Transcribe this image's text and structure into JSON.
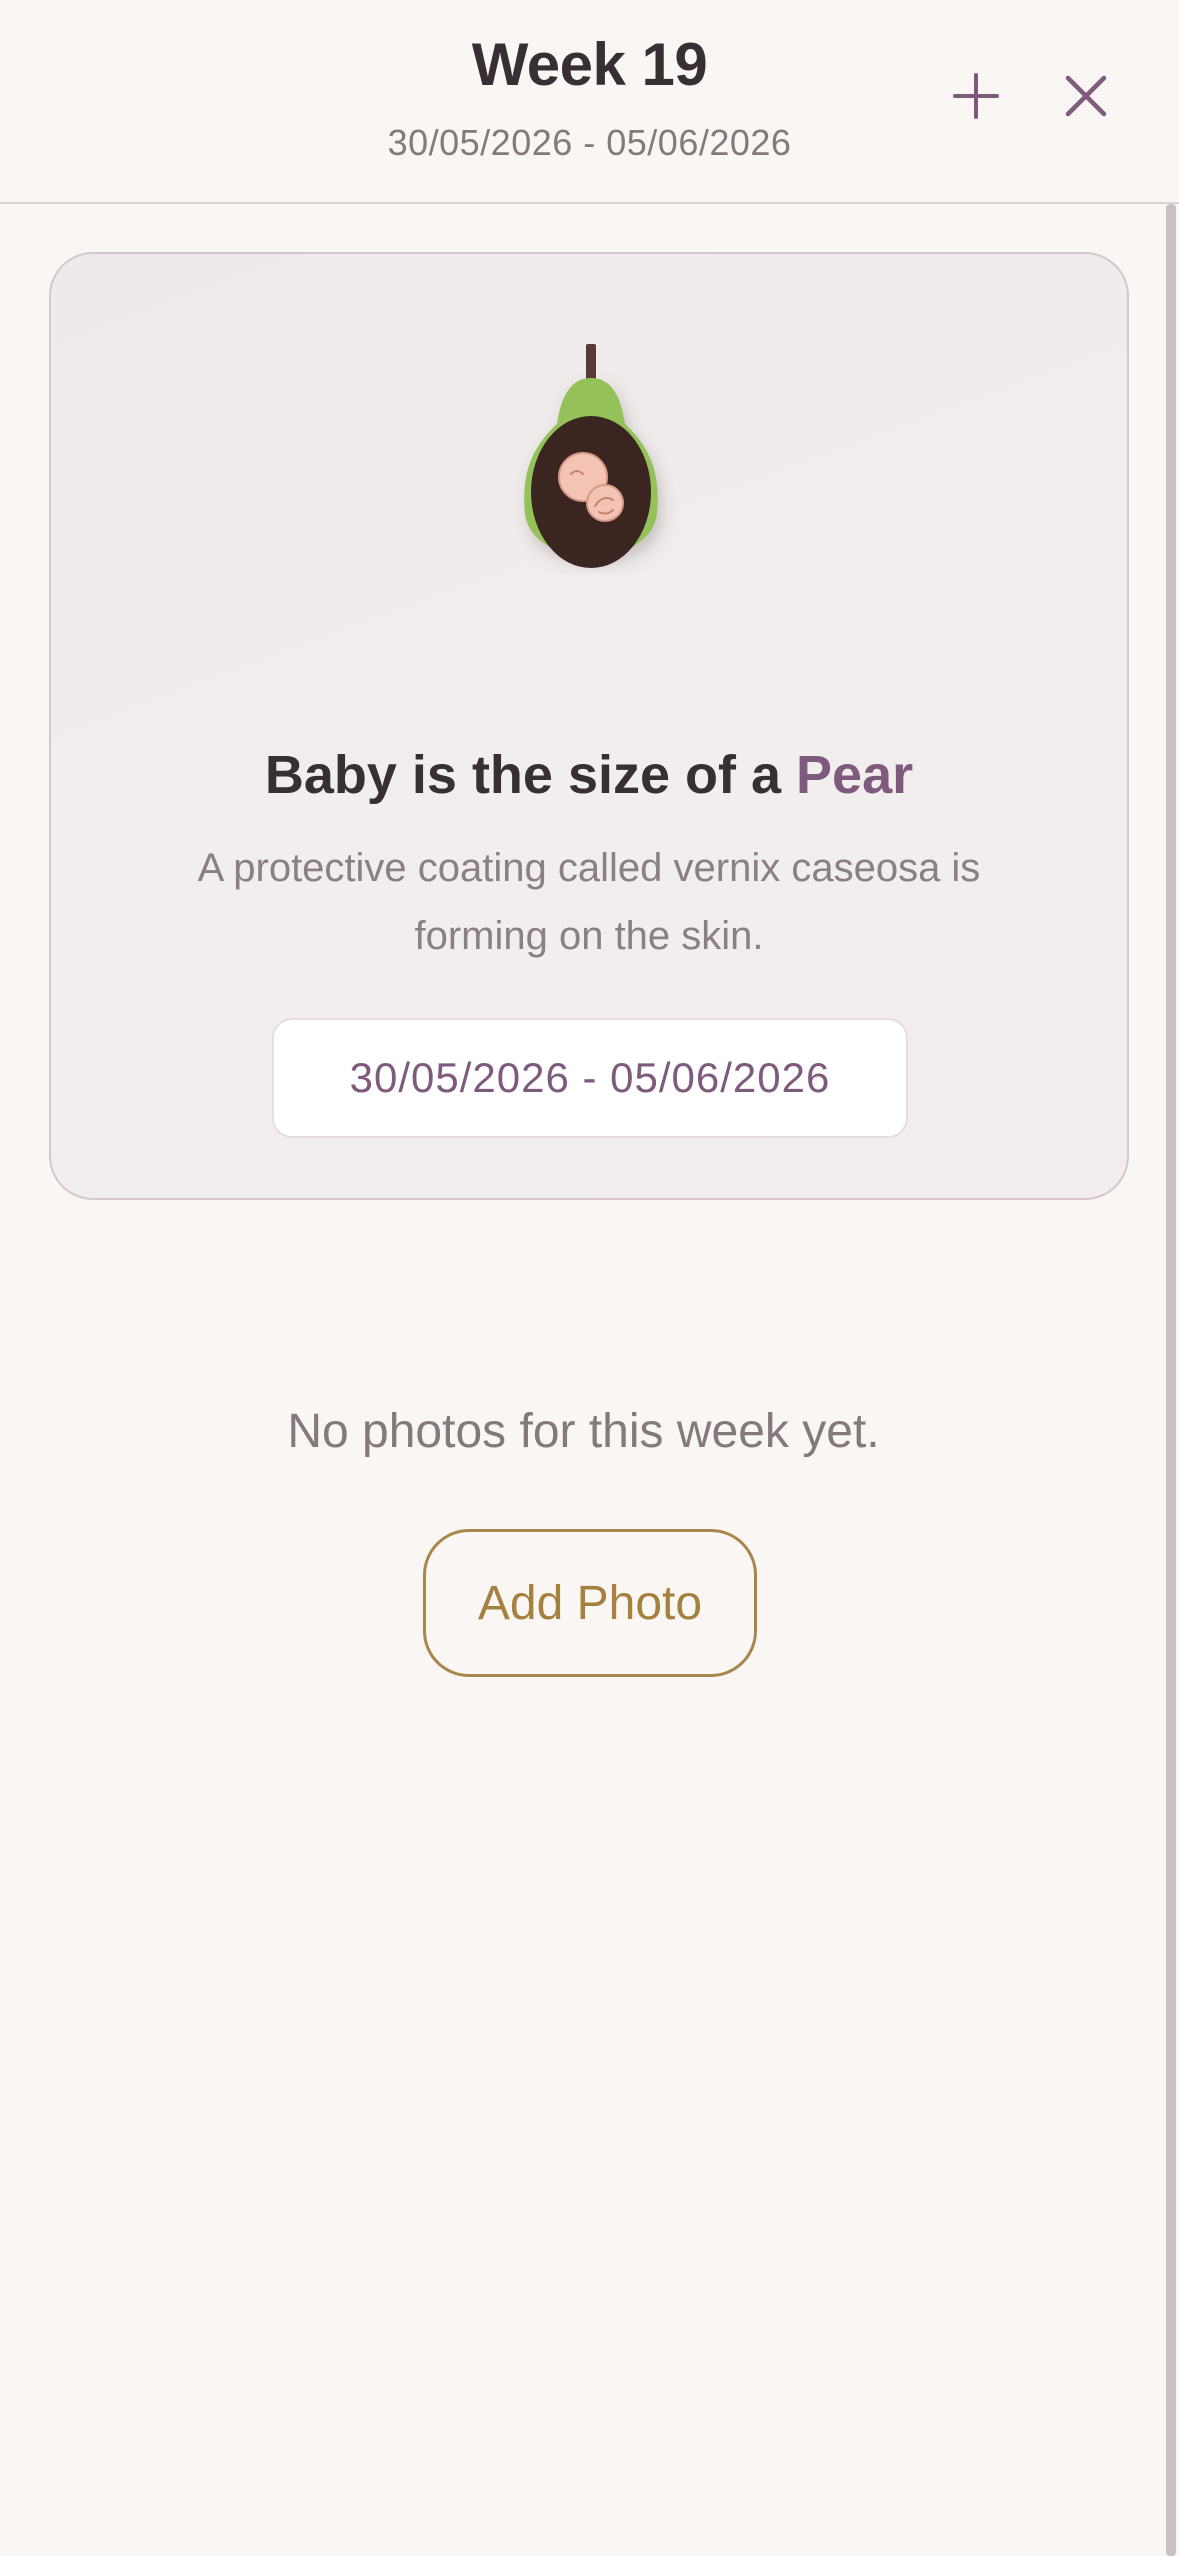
{
  "header": {
    "title": "Week 19",
    "date_range": "30/05/2026 - 05/06/2026",
    "add_icon": "plus-icon",
    "close_icon": "close-icon"
  },
  "card": {
    "illustration": "pear-with-baby-icon",
    "heading_prefix": "Baby is the size of a ",
    "fruit": "Pear",
    "description": "A protective coating called vernix caseosa is forming on the skin.",
    "date_range": "30/05/2026 - 05/06/2026"
  },
  "photos": {
    "empty_message": "No photos for this week yet.",
    "add_button_label": "Add Photo"
  },
  "colors": {
    "accent": "#7e5a7c",
    "gold": "#a5813f",
    "background": "#faf6f3",
    "pear_green": "#94c15a"
  }
}
